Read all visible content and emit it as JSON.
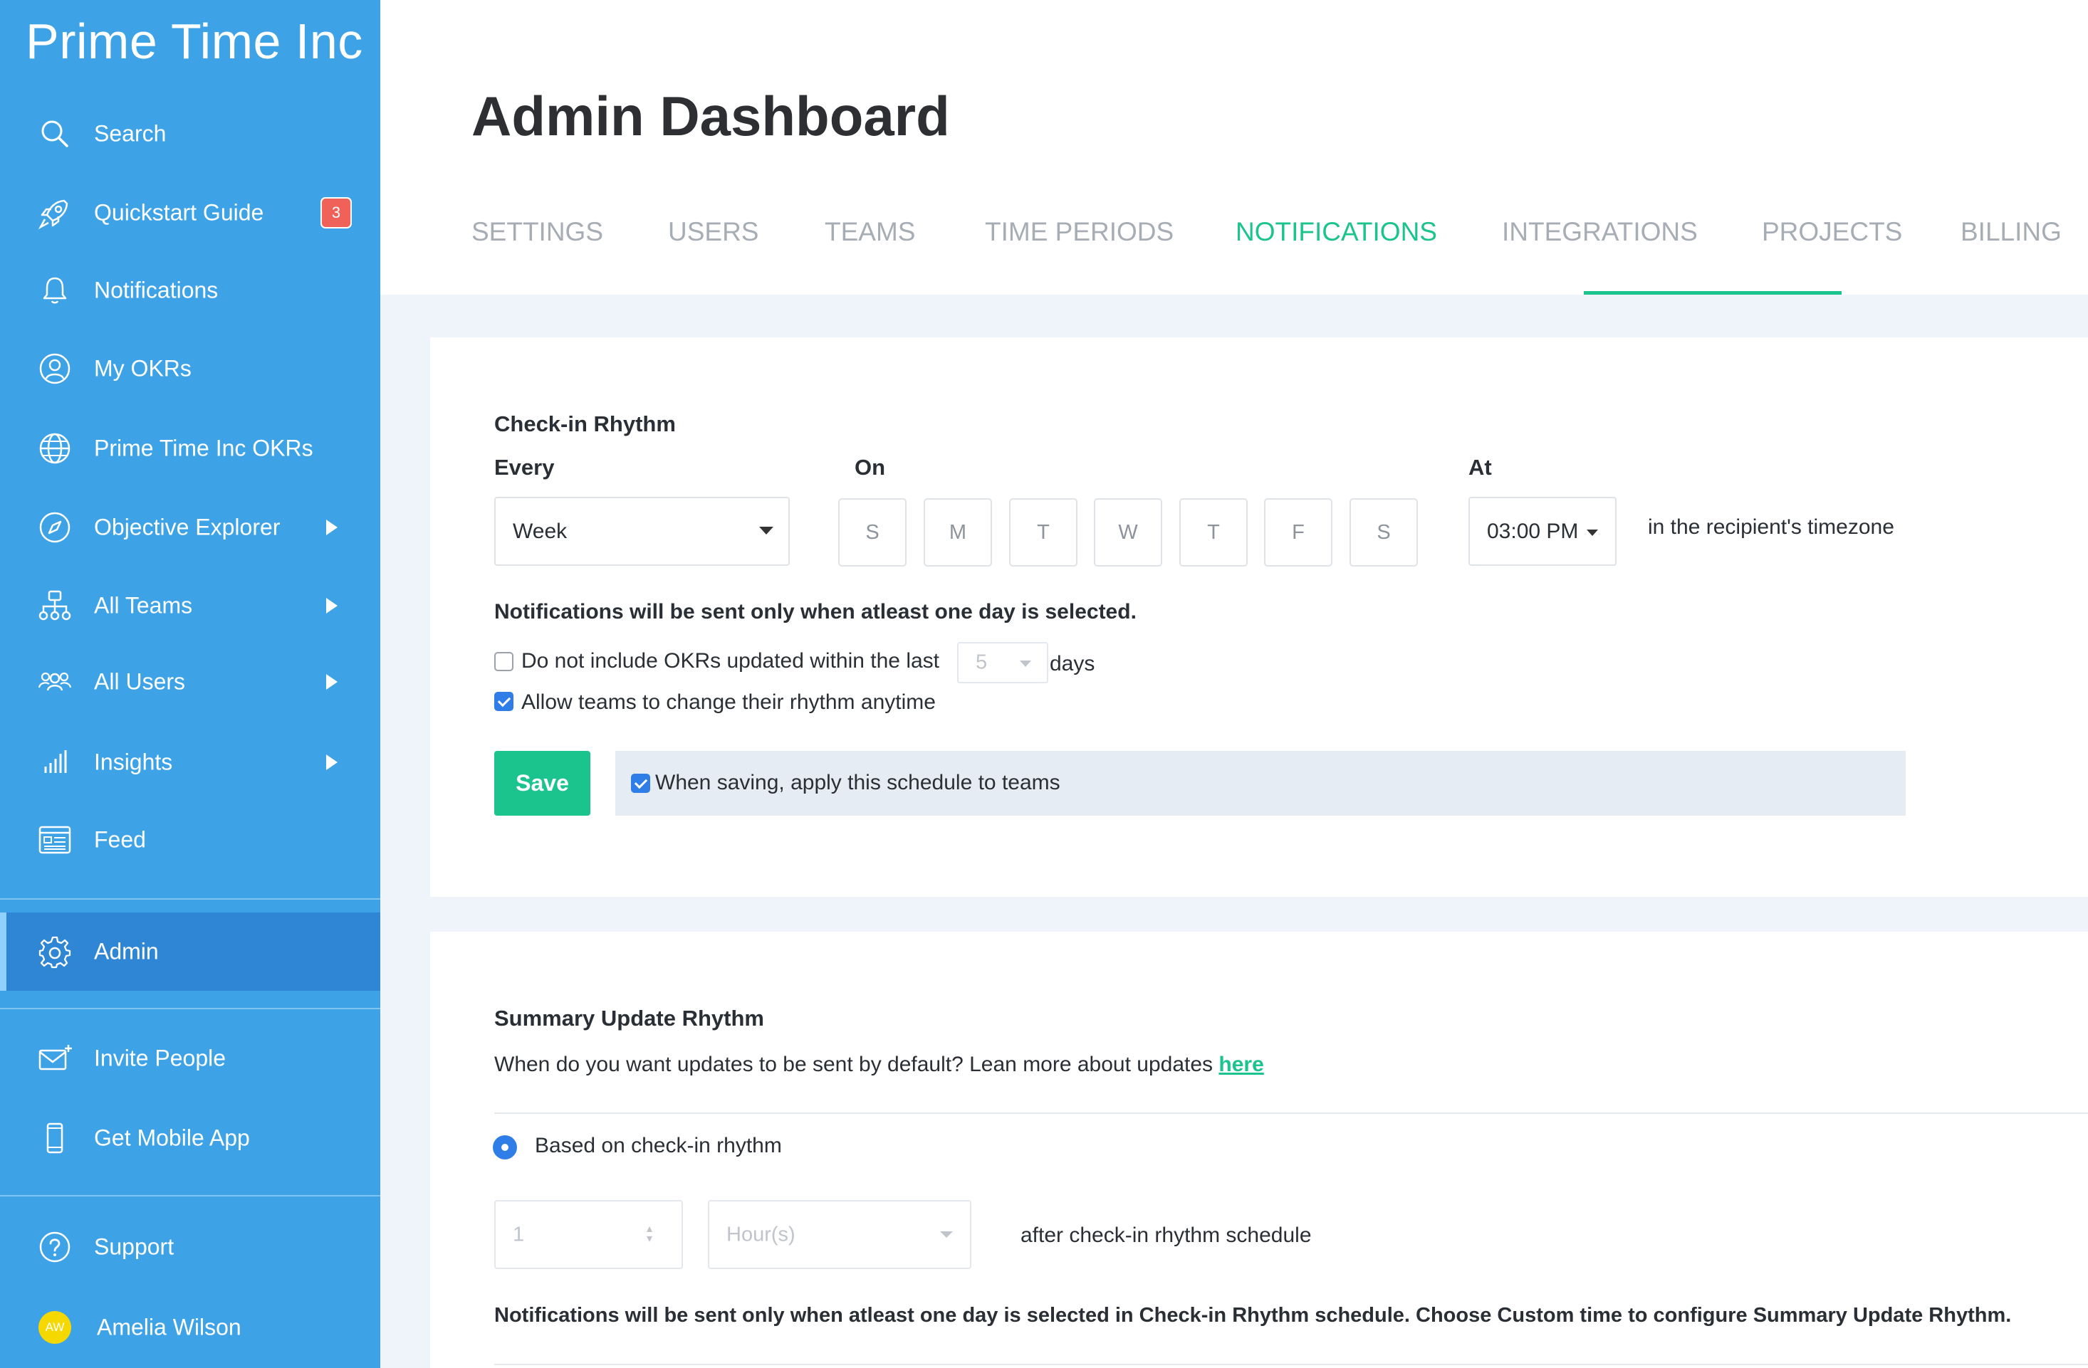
{
  "app": {
    "brand": "Prime Time Inc"
  },
  "sidebar": {
    "items": [
      {
        "label": "Search",
        "icon": "search-icon"
      },
      {
        "label": "Quickstart Guide",
        "icon": "rocket-icon",
        "badge": "3"
      },
      {
        "label": "Notifications",
        "icon": "bell-icon"
      },
      {
        "label": "My OKRs",
        "icon": "user-circle-icon"
      },
      {
        "label": "Prime Time Inc OKRs",
        "icon": "globe-icon"
      },
      {
        "label": "Objective Explorer",
        "icon": "compass-icon"
      },
      {
        "label": "All Teams",
        "icon": "org-chart-icon"
      },
      {
        "label": "All Users",
        "icon": "users-icon"
      },
      {
        "label": "Insights",
        "icon": "bar-chart-icon"
      },
      {
        "label": "Feed",
        "icon": "newspaper-icon"
      },
      {
        "label": "Admin",
        "icon": "gear-icon",
        "active": true
      },
      {
        "label": "Invite People",
        "icon": "envelope-plus-icon"
      },
      {
        "label": "Get Mobile App",
        "icon": "mobile-icon"
      },
      {
        "label": "Support",
        "icon": "question-circle-icon"
      }
    ],
    "user": {
      "name": "Amelia Wilson",
      "initials": "AW"
    }
  },
  "header": {
    "title": "Admin Dashboard",
    "tabs": [
      "SETTINGS",
      "USERS",
      "TEAMS",
      "TIME PERIODS",
      "NOTIFICATIONS",
      "INTEGRATIONS",
      "PROJECTS",
      "BILLING"
    ],
    "active_tab": "NOTIFICATIONS"
  },
  "checkin": {
    "title": "Check-in Rhythm",
    "every_label": "Every",
    "on_label": "On",
    "at_label": "At",
    "every_value": "Week",
    "days": [
      "S",
      "M",
      "T",
      "W",
      "T",
      "F",
      "S"
    ],
    "time_value": "03:00 PM",
    "timezone_text": "in the recipient's timezone",
    "warning": "Notifications will be sent only when atleast one day is selected.",
    "exclude_label": "Do not include OKRs updated within the last",
    "exclude_checked": false,
    "exclude_days_value": "5",
    "days_suffix": "days",
    "allow_change_label": "Allow teams to change their rhythm anytime",
    "allow_change_checked": true,
    "save_label": "Save",
    "apply_label": "When saving, apply this schedule to teams",
    "apply_checked": true
  },
  "summary": {
    "title": "Summary Update Rhythm",
    "description": "When do you want updates to be sent by default? Lean more about updates",
    "link_text": "here",
    "radio_label": "Based on check-in rhythm",
    "amount_value": "1",
    "unit_value": "Hour(s)",
    "after_text": "after check-in rhythm schedule",
    "note": "Notifications will be sent only when atleast one day is selected in Check-in Rhythm schedule. Choose Custom time to configure Summary Update Rhythm."
  },
  "colors": {
    "sidebar": "#3ea3e6",
    "sidebar_active": "#2f86d4",
    "accent": "#1bc48d",
    "checkbox": "#2f7ee8",
    "badge": "#f0615a"
  }
}
